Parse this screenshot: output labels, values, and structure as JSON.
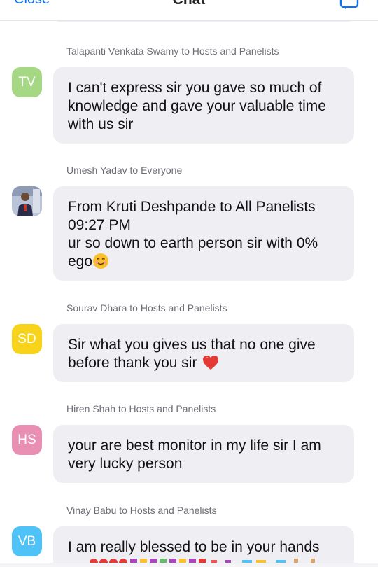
{
  "header": {
    "left_label": "Close",
    "title": "Chat",
    "right_icon": "participants-icon",
    "accent": "#0e72ed"
  },
  "messages": [
    {
      "sender": "Talapanti Venkata Swamy to Hosts and Panelists",
      "avatar_initials": "TV",
      "avatar_color": "#a6d784",
      "lines": [
        "I can't express sir you gave so much of",
        "knowledge and gave your valuable time",
        "with us sir"
      ]
    },
    {
      "sender": "Umesh Yadav to Everyone",
      "avatar_initials": "",
      "avatar_type": "photo",
      "lines": [
        "From Kruti Deshpande to All Panelists",
        "09:27 PM",
        "ur so down to earth person sir with 0%",
        "ego"
      ],
      "trailing_emoji": "smiling-face-icon"
    },
    {
      "sender": "Sourav Dhara to Hosts and Panelists",
      "avatar_initials": "SD",
      "avatar_color": "#f7d41b",
      "lines": [
        "Sir what you gives us that no one give",
        "before thank you sir"
      ],
      "trailing_emoji": "red-heart-icon"
    },
    {
      "sender": "Hiren Shah to Hosts and Panelists",
      "avatar_initials": "HS",
      "avatar_color": "#e88fb3",
      "lines": [
        "your are best monitor in my life sir I am",
        "very lucky person"
      ]
    },
    {
      "sender": "Vinay Babu to Hosts and Panelists",
      "avatar_initials": "VB",
      "avatar_color": "#4fc3f7",
      "lines": [
        "I am really blessed to be in your hands"
      ]
    }
  ]
}
